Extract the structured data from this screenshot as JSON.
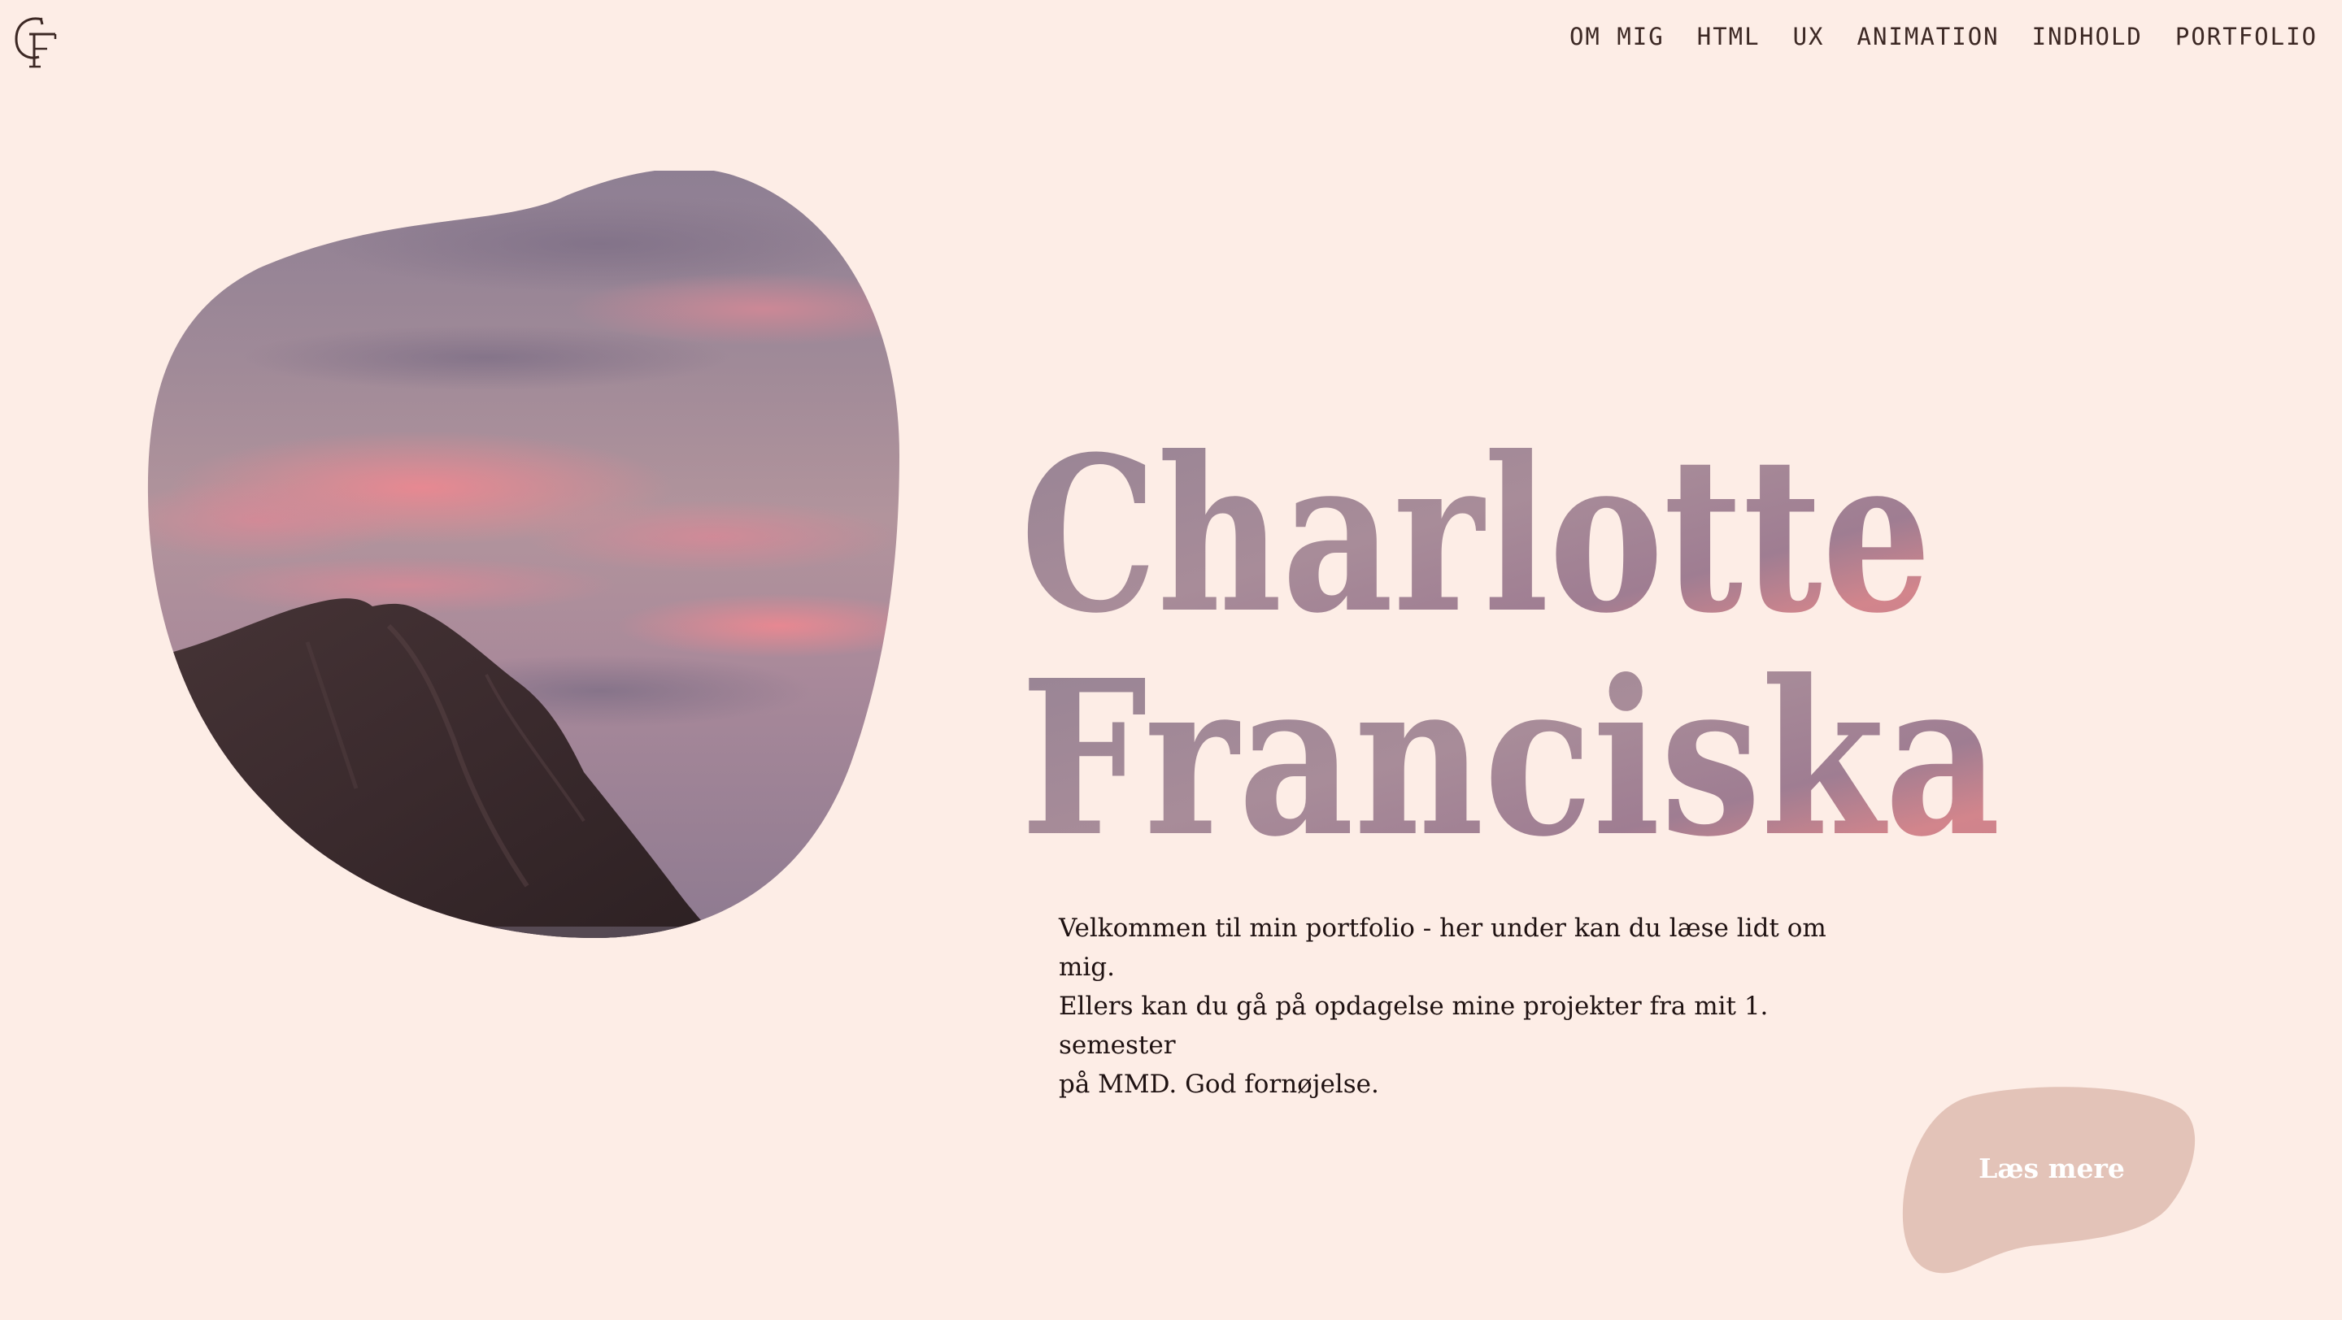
{
  "header": {
    "logo_initials": "CF",
    "nav": [
      {
        "label": "OM MIG"
      },
      {
        "label": "HTML"
      },
      {
        "label": "UX"
      },
      {
        "label": "ANIMATION"
      },
      {
        "label": "INDHOLD"
      },
      {
        "label": "PORTFOLIO"
      }
    ]
  },
  "hero": {
    "image_subject": "pink sunset sky over dark mountain",
    "title_line1": "Charlotte",
    "title_line2": "Franciska",
    "intro": "Velkommen til min portfolio - her under kan du læse lidt om mig.\nEllers kan du gå på opdagelse mine projekter fra mit 1. semester\npå MMD. God fornøjelse.",
    "cta_label": "Læs mere"
  },
  "colors": {
    "background": "#fdede6",
    "nav_text": "#3c2824",
    "cta_fill": "#e3c3b8",
    "title_gradient_top": "#9b8596",
    "title_gradient_bottom": "#c98189"
  }
}
